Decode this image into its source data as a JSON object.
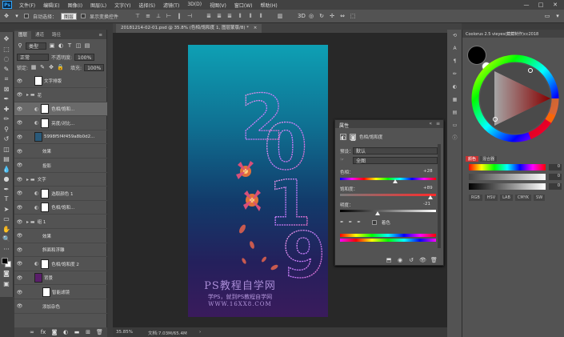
{
  "app": {
    "logo": "Ps"
  },
  "menu": [
    "文件(F)",
    "编辑(E)",
    "图像(I)",
    "图层(L)",
    "文字(Y)",
    "选择(S)",
    "滤镜(T)",
    "3D(D)",
    "视图(V)",
    "窗口(W)",
    "帮助(H)"
  ],
  "window_controls": {
    "minimize": "—",
    "maximize": "□",
    "close": "✕"
  },
  "options": {
    "auto_select_label": "自动选择：",
    "auto_select_value": "图层",
    "transform_label": "显示变换控件"
  },
  "layers_panel": {
    "tabs": [
      "图层",
      "通道",
      "路径"
    ],
    "filter_label": "类型",
    "blend_mode": "正常",
    "opacity_label": "不透明度:",
    "opacity_value": "100%",
    "lock_label": "锁定:",
    "fill_label": "填充:",
    "fill_value": "100%",
    "layers": [
      {
        "name": "文字排版",
        "kind": "thumb"
      },
      {
        "name": "花",
        "kind": "folder"
      },
      {
        "name": "色相/饱和...",
        "kind": "adj"
      },
      {
        "name": "亮度/对比...",
        "kind": "adj"
      },
      {
        "name": "5998f5f4f459a8b0d2...",
        "kind": "img"
      },
      {
        "name": "效果",
        "kind": "fx"
      },
      {
        "name": "投影",
        "kind": "fx"
      },
      {
        "name": "文字",
        "kind": "folder"
      },
      {
        "name": "选取颜色 1",
        "kind": "adj"
      },
      {
        "name": "色相/饱和...",
        "kind": "adj"
      },
      {
        "name": "组 1",
        "kind": "folder"
      },
      {
        "name": "效果",
        "kind": "fx"
      },
      {
        "name": "斜面和浮雕",
        "kind": "fx"
      },
      {
        "name": "色相/饱和度 2",
        "kind": "adj"
      },
      {
        "name": "背景",
        "kind": "bg"
      },
      {
        "name": "智能滤镜",
        "kind": "sf"
      },
      {
        "name": "添加杂色",
        "kind": "sf"
      }
    ]
  },
  "document": {
    "tab_title": "20181214-02-01.psd @ 35.8% (色相/饱和度 1, 图层蒙版/8) *",
    "zoom": "35.85%",
    "doc_size": "文档:7.03M/65.4M",
    "year_text": "2019",
    "watermark_title": "PS教程自学网",
    "watermark_sub": "学PS，就到PS教程自学网",
    "watermark_url": "WWW.16XX8.COM"
  },
  "properties": {
    "title": "属性",
    "adj_name": "色相/饱和度",
    "preset_label": "预设：",
    "preset_value": "默认",
    "channel_value": "全图",
    "hue_label": "色相：",
    "hue_value": "+28",
    "hue": 28,
    "sat_label": "饱和度：",
    "sat_value": "+89",
    "sat": 89,
    "light_label": "明度：",
    "light_value": "-21",
    "light": -21,
    "colorize_label": "着色"
  },
  "coolorus": {
    "title": "Coolorus 2.5 vieyes(藏藏制作)cc2018",
    "tabs": [
      "颜色",
      "混合器"
    ],
    "modes": [
      "RGB",
      "HSV",
      "LAB",
      "CMYK",
      "SW"
    ],
    "r_value": "0",
    "g_value": "0",
    "b_value": "0",
    "fg_color": "#000000",
    "bg_color": "#ffffff"
  }
}
